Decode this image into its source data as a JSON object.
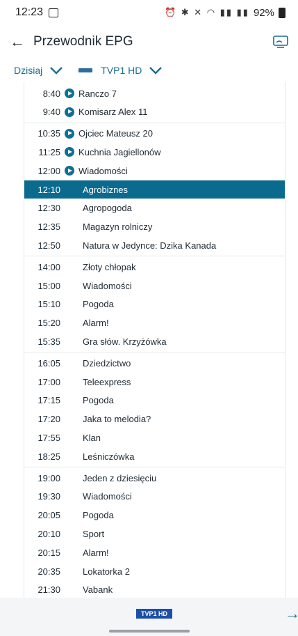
{
  "status_bar": {
    "time": "12:23",
    "battery": "92%",
    "icons": [
      "alarm-icon",
      "bluetooth-icon",
      "mute-icon",
      "wifi-icon",
      "signal-icon",
      "signal-icon",
      "battery-icon"
    ]
  },
  "app_bar": {
    "title": "Przewodnik EPG",
    "back_icon": "back-arrow-icon",
    "cast_icon": "cast-icon"
  },
  "filters": {
    "day": "Dzisiaj",
    "channel": "TVP1 HD"
  },
  "programs": [
    {
      "time": "8:40",
      "title": "Ranczo 7",
      "play": true
    },
    {
      "time": "9:40",
      "title": "Komisarz Alex 11",
      "play": true
    },
    {
      "time": "10:35",
      "title": "Ojciec Mateusz 20",
      "play": true
    },
    {
      "time": "11:25",
      "title": "Kuchnia Jagiellonów",
      "play": true
    },
    {
      "time": "12:00",
      "title": "Wiadomości",
      "play": true
    },
    {
      "time": "12:10",
      "title": "Agrobiznes",
      "play": false,
      "selected": true
    },
    {
      "time": "12:30",
      "title": "Agropogoda",
      "play": false
    },
    {
      "time": "12:35",
      "title": "Magazyn rolniczy",
      "play": false
    },
    {
      "time": "12:50",
      "title": "Natura w Jedynce: Dzika Kanada",
      "play": false
    },
    {
      "time": "14:00",
      "title": "Złoty chłopak",
      "play": false
    },
    {
      "time": "15:00",
      "title": "Wiadomości",
      "play": false
    },
    {
      "time": "15:10",
      "title": "Pogoda",
      "play": false
    },
    {
      "time": "15:20",
      "title": "Alarm!",
      "play": false
    },
    {
      "time": "15:35",
      "title": "Gra słów. Krzyżówka",
      "play": false
    },
    {
      "time": "16:05",
      "title": "Dziedzictwo",
      "play": false
    },
    {
      "time": "17:00",
      "title": "Teleexpress",
      "play": false
    },
    {
      "time": "17:15",
      "title": "Pogoda",
      "play": false
    },
    {
      "time": "17:20",
      "title": "Jaka to melodia?",
      "play": false
    },
    {
      "time": "17:55",
      "title": "Klan",
      "play": false
    },
    {
      "time": "18:25",
      "title": "Leśniczówka",
      "play": false
    },
    {
      "time": "19:00",
      "title": "Jeden z dziesięciu",
      "play": false
    },
    {
      "time": "19:30",
      "title": "Wiadomości",
      "play": false
    },
    {
      "time": "20:05",
      "title": "Pogoda",
      "play": false
    },
    {
      "time": "20:10",
      "title": "Sport",
      "play": false
    },
    {
      "time": "20:15",
      "title": "Alarm!",
      "play": false
    },
    {
      "time": "20:35",
      "title": "Lokatorka 2",
      "play": false
    },
    {
      "time": "21:30",
      "title": "Vabank",
      "play": false
    }
  ],
  "bottom_bar": {
    "logo_text": "TVP1 HD",
    "next_icon": "arrow-right-icon"
  },
  "colors": {
    "accent": "#0b6b8f",
    "selected_row": "#0b6b8f"
  }
}
